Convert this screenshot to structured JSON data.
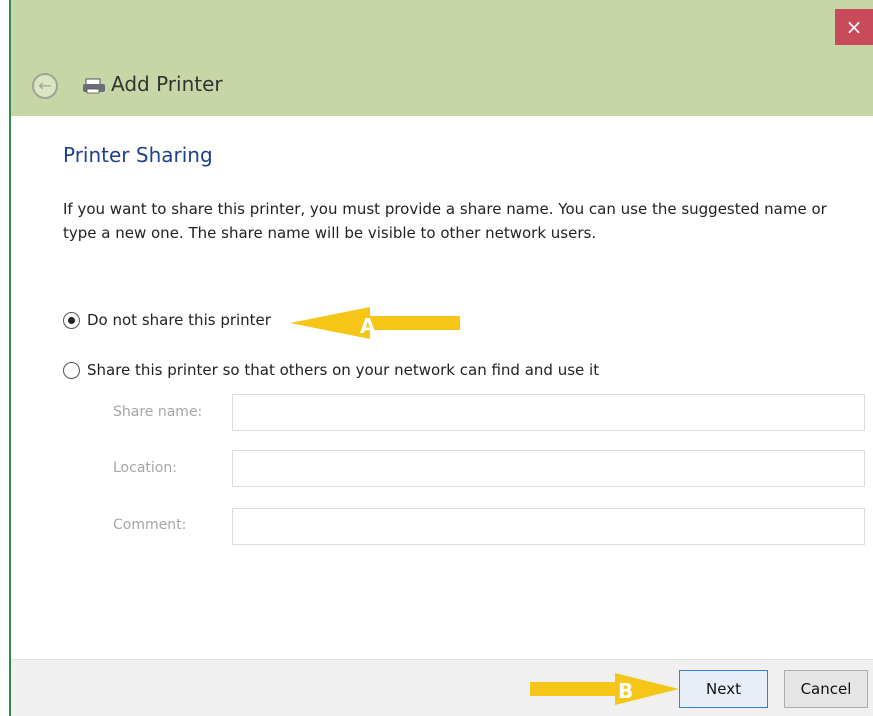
{
  "window": {
    "title": "Add Printer",
    "close_glyph": "×",
    "back_glyph": "←"
  },
  "page": {
    "heading": "Printer Sharing",
    "description": "If you want to share this printer, you must provide a share name. You can use the suggested name or type a new one. The share name will be visible to other network users."
  },
  "options": [
    {
      "label": "Do not share this printer",
      "checked": true
    },
    {
      "label": "Share this printer so that others on your network can find and use it",
      "checked": false
    }
  ],
  "fields": [
    {
      "label": "Share name:",
      "value": ""
    },
    {
      "label": "Location:",
      "value": ""
    },
    {
      "label": "Comment:",
      "value": ""
    }
  ],
  "buttons": {
    "next": "Next",
    "cancel": "Cancel"
  },
  "annotations": {
    "a": "A",
    "b": "B"
  },
  "colors": {
    "titlebar": "#c7d6a6",
    "heading": "#1f3f8f",
    "close": "#c94a5a",
    "arrow": "#f5c518"
  }
}
